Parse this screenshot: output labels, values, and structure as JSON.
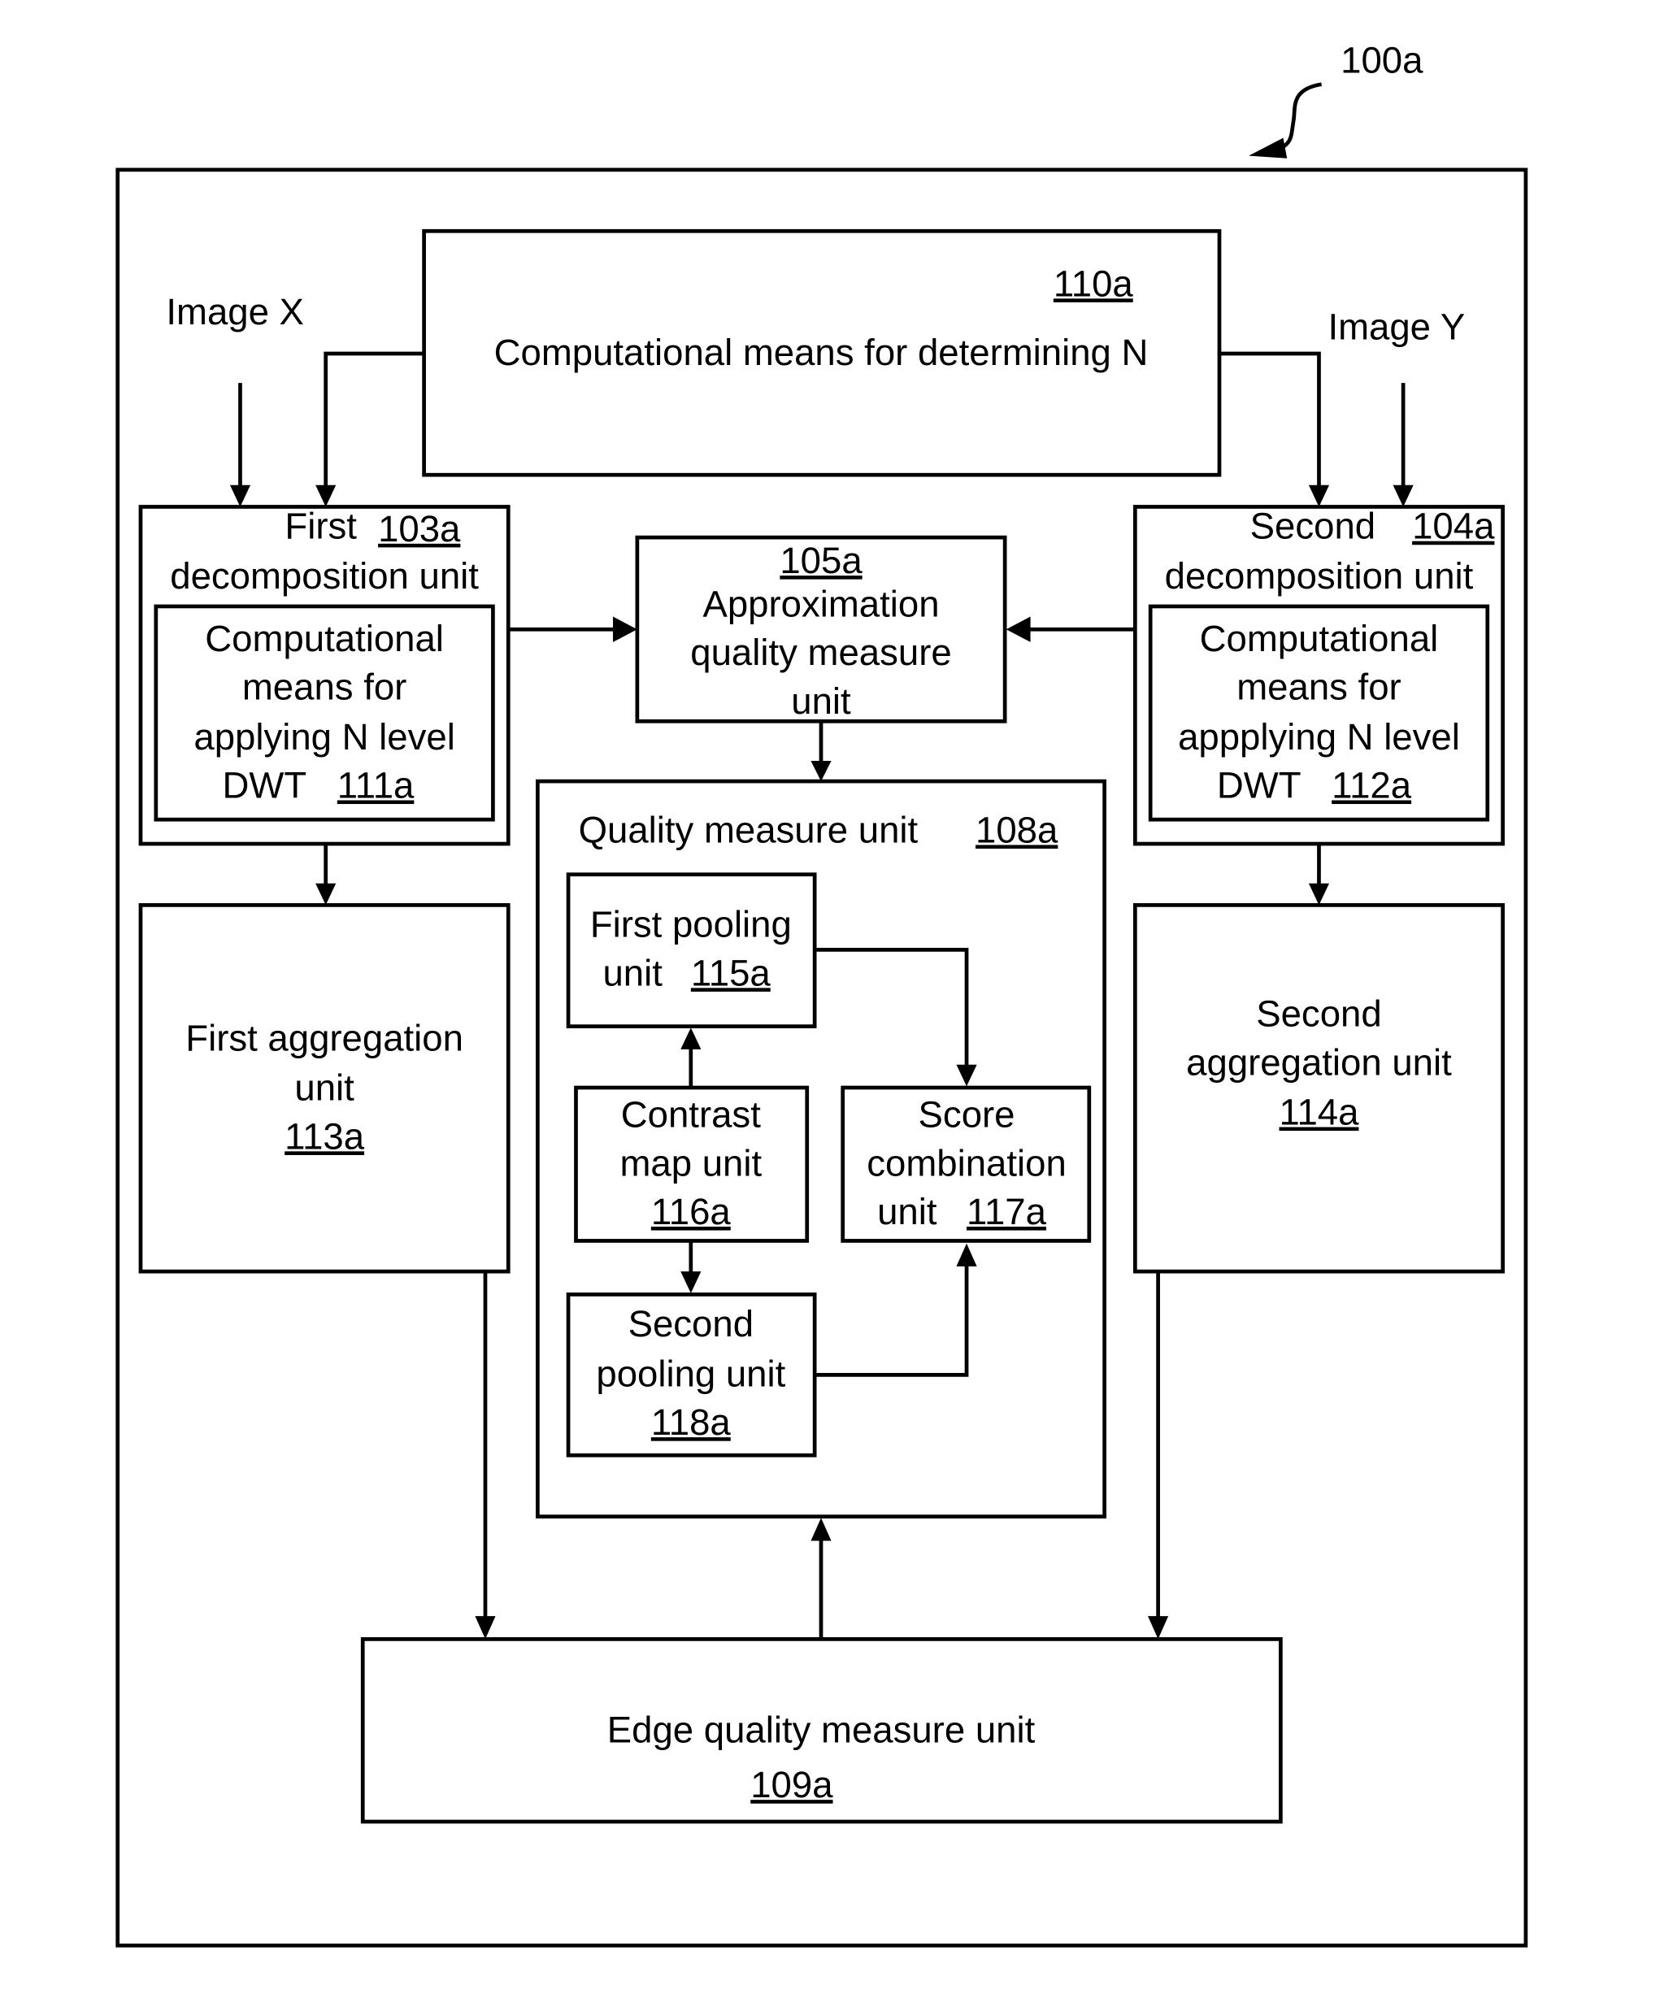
{
  "figure_ref": "100a",
  "inputs": {
    "image_x": "Image X",
    "image_y": "Image Y"
  },
  "blocks": {
    "determine_n": {
      "label": "Computational means for determining N",
      "ref": "110a"
    },
    "first_decomp": {
      "line1": "First",
      "line2": "decomposition unit",
      "ref": "103a"
    },
    "first_dwt": {
      "lines": [
        "Computational",
        "means for",
        "applying N level",
        "DWT"
      ],
      "ref": "111a"
    },
    "second_decomp": {
      "line1": "Second",
      "line2": "decomposition unit",
      "ref": "104a"
    },
    "second_dwt": {
      "lines": [
        "Computational",
        "means for",
        "appplying N level",
        "DWT"
      ],
      "ref": "112a"
    },
    "approx_quality": {
      "lines": [
        "Approximation",
        "quality measure",
        "unit"
      ],
      "ref": "105a"
    },
    "quality_measure": {
      "label": "Quality measure unit",
      "ref": "108a"
    },
    "first_pooling": {
      "lines": [
        "First pooling",
        "unit"
      ],
      "ref": "115a"
    },
    "contrast_map": {
      "lines": [
        "Contrast",
        "map unit"
      ],
      "ref": "116a"
    },
    "score_combination": {
      "lines": [
        "Score",
        "combination",
        "unit"
      ],
      "ref": "117a"
    },
    "second_pooling": {
      "lines": [
        "Second",
        "pooling unit"
      ],
      "ref": "118a"
    },
    "first_aggregation": {
      "lines": [
        "First aggregation",
        "unit"
      ],
      "ref": "113a"
    },
    "second_aggregation": {
      "lines": [
        "Second",
        "aggregation unit"
      ],
      "ref": "114a"
    },
    "edge_quality": {
      "label": "Edge quality measure unit",
      "ref": "109a"
    }
  }
}
